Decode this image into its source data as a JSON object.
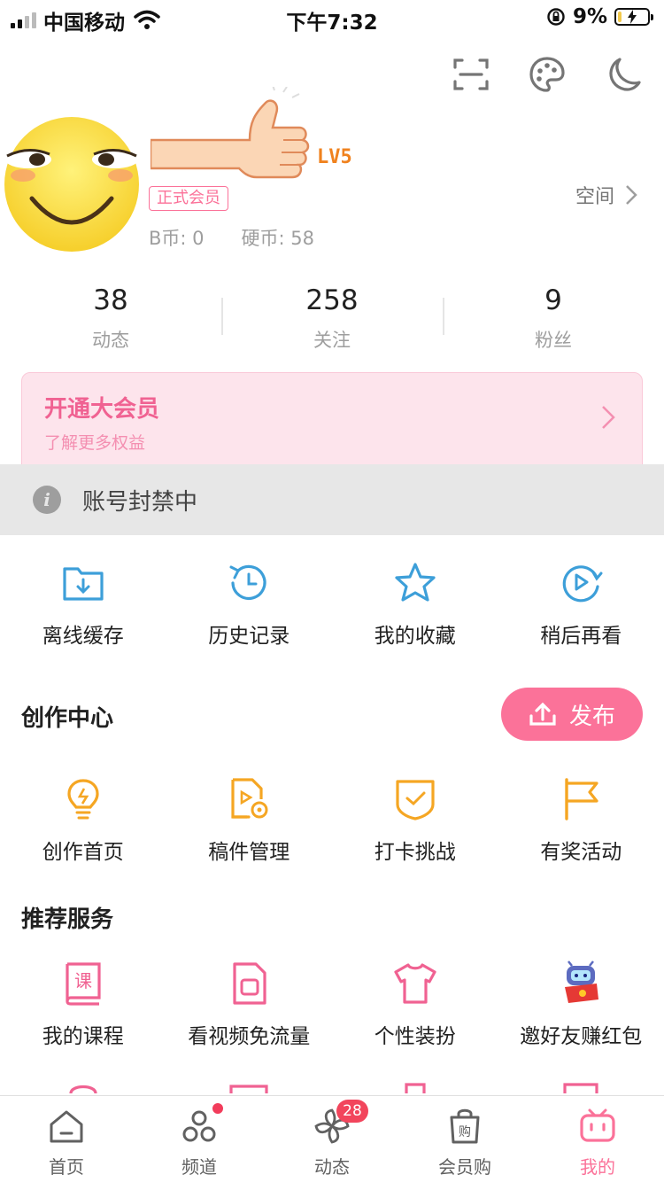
{
  "status_bar": {
    "carrier": "中国移动",
    "time": "下午7:32",
    "battery": "9%"
  },
  "top_icons": [
    "scan-icon",
    "palette-icon",
    "moon-icon"
  ],
  "profile": {
    "level": "LV5",
    "member_tag": "正式会员",
    "b_coin": "B币: 0",
    "hard_coin": "硬币: 58",
    "space_label": "空间"
  },
  "stats": [
    {
      "value": "38",
      "label": "动态"
    },
    {
      "value": "258",
      "label": "关注"
    },
    {
      "value": "9",
      "label": "粉丝"
    }
  ],
  "vip": {
    "title": "开通大会员",
    "subtitle": "了解更多权益"
  },
  "banned": {
    "text": "账号封禁中"
  },
  "quick": [
    {
      "label": "离线缓存",
      "icon": "offline-cache-icon"
    },
    {
      "label": "历史记录",
      "icon": "history-icon"
    },
    {
      "label": "我的收藏",
      "icon": "favorites-star-icon"
    },
    {
      "label": "稍后再看",
      "icon": "watch-later-icon"
    }
  ],
  "creation": {
    "title": "创作中心",
    "publish_label": "发布",
    "items": [
      {
        "label": "创作首页",
        "icon": "lightbulb-icon"
      },
      {
        "label": "稿件管理",
        "icon": "manuscript-icon"
      },
      {
        "label": "打卡挑战",
        "icon": "checkin-shield-icon"
      },
      {
        "label": "有奖活动",
        "icon": "flag-icon"
      }
    ]
  },
  "services": {
    "title": "推荐服务",
    "items": [
      {
        "label": "我的课程",
        "icon": "course-book-icon"
      },
      {
        "label": "看视频免流量",
        "icon": "sim-card-icon"
      },
      {
        "label": "个性装扮",
        "icon": "tshirt-icon"
      },
      {
        "label": "邀好友赚红包",
        "icon": "robot-redpacket-icon"
      }
    ]
  },
  "tabbar": [
    {
      "label": "首页",
      "icon": "home-icon"
    },
    {
      "label": "频道",
      "icon": "channel-icon",
      "dot": true
    },
    {
      "label": "动态",
      "icon": "pinwheel-icon",
      "badge": "28"
    },
    {
      "label": "会员购",
      "icon": "shopping-bag-icon"
    },
    {
      "label": "我的",
      "icon": "tv-mine-icon",
      "active": true
    }
  ],
  "colors": {
    "accent": "#fb7299",
    "blue_icon": "#3d9fd9",
    "yellow_icon": "#f5a623",
    "banned_bg": "#e7e7e7"
  }
}
